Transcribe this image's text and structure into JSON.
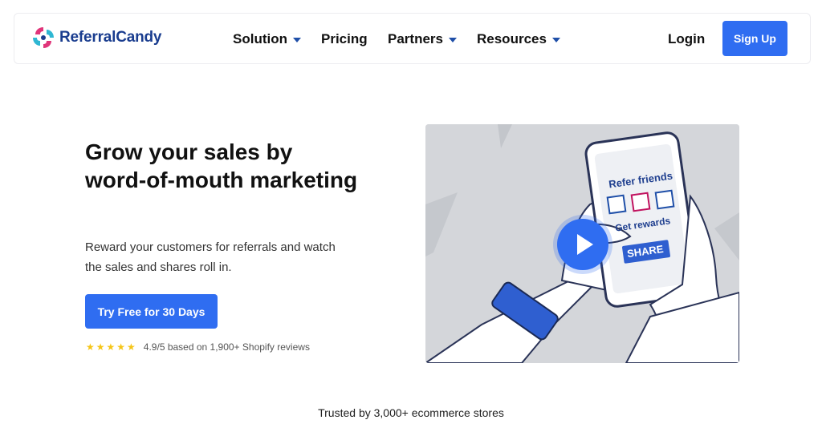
{
  "brand": {
    "name": "ReferralCandy"
  },
  "nav": {
    "items": [
      {
        "label": "Solution",
        "dropdown": true
      },
      {
        "label": "Pricing",
        "dropdown": false
      },
      {
        "label": "Partners",
        "dropdown": true
      },
      {
        "label": "Resources",
        "dropdown": true
      }
    ],
    "login_label": "Login",
    "signup_label": "Sign Up"
  },
  "hero": {
    "title": "Grow your sales by word-of-mouth marketing",
    "subtitle": "Reward your customers for referrals and watch the sales and shares roll in.",
    "cta_label": "Try Free for 30 Days",
    "rating_stars": 5,
    "rating_text": "4.9/5 based on 1,900+ Shopify reviews"
  },
  "video": {
    "phone_heading": "Refer friends",
    "phone_subheading": "Get rewards",
    "share_label": "SHARE"
  },
  "footer": {
    "trusted_text": "Trusted by 3,000+ ecommerce stores"
  },
  "colors": {
    "accent": "#2f6df1",
    "brand_dark": "#1a3d8f",
    "logo_pink": "#e0357a",
    "logo_teal": "#2fb7d3",
    "star": "#f5c518"
  }
}
